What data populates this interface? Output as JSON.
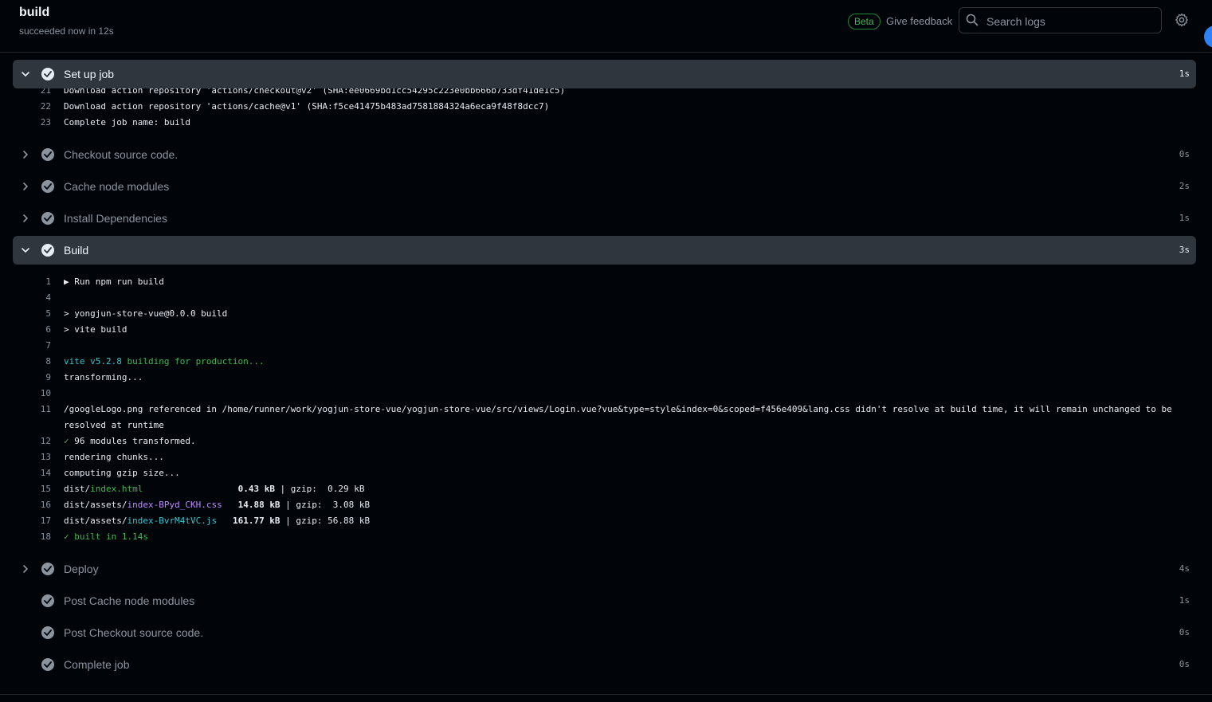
{
  "header": {
    "title": "build",
    "status": "succeeded now in 12s",
    "beta_label": "Beta",
    "feedback_label": "Give feedback",
    "search_placeholder": "Search logs"
  },
  "steps": [
    {
      "name": "Set up job",
      "duration": "1s",
      "expanded": true,
      "icon": "chevron-down-icon"
    },
    {
      "name": "Checkout source code.",
      "duration": "0s",
      "expanded": false,
      "icon": "chevron-right-icon"
    },
    {
      "name": "Cache node modules",
      "duration": "2s",
      "expanded": false,
      "icon": "chevron-right-icon"
    },
    {
      "name": "Install Dependencies",
      "duration": "1s",
      "expanded": false,
      "icon": "chevron-right-icon"
    },
    {
      "name": "Build",
      "duration": "3s",
      "expanded": true,
      "icon": "chevron-down-icon"
    },
    {
      "name": "Deploy",
      "duration": "4s",
      "expanded": false,
      "icon": "chevron-right-icon"
    },
    {
      "name": "Post Cache node modules",
      "duration": "1s",
      "expanded": false,
      "icon": "none"
    },
    {
      "name": "Post Checkout source code.",
      "duration": "0s",
      "expanded": false,
      "icon": "none"
    },
    {
      "name": "Complete job",
      "duration": "0s",
      "expanded": false,
      "icon": "none"
    }
  ],
  "setup_log": [
    {
      "n": "21",
      "t": "Download action repository 'actions/checkout@v2' (SHA:ee0669bd1cc54295c223e0bb666b733df41de1c5)"
    },
    {
      "n": "22",
      "t": "Download action repository 'actions/cache@v1' (SHA:f5ce41475b483ad7581884324a6eca9f48f8dcc7)"
    },
    {
      "n": "23",
      "t": "Complete job name: build"
    }
  ],
  "build_log": {
    "l1": {
      "n": "1",
      "t": "▶ Run npm run build"
    },
    "l4": {
      "n": "4"
    },
    "l5": {
      "n": "5",
      "t": "> yongjun-store-vue@0.0.0 build"
    },
    "l6": {
      "n": "6",
      "t": "> vite build"
    },
    "l7": {
      "n": "7"
    },
    "l8": {
      "n": "8",
      "a": "vite v5.2.8",
      "b": " building for production..."
    },
    "l9": {
      "n": "9",
      "t": "transforming..."
    },
    "l10": {
      "n": "10"
    },
    "l11": {
      "n": "11",
      "t": "/googleLogo.png referenced in /home/runner/work/yogjun-store-vue/yogjun-store-vue/src/views/Login.vue?vue&type=style&index=0&scoped=f456e409&lang.css didn't resolve at build time, it will remain unchanged to be resolved at runtime"
    },
    "l12": {
      "n": "12",
      "a": "✓",
      "b": " 96 modules transformed."
    },
    "l13": {
      "n": "13",
      "t": "rendering chunks..."
    },
    "l14": {
      "n": "14",
      "t": "computing gzip size..."
    },
    "l15": {
      "n": "15",
      "pre": "dist/",
      "file": "index.html",
      "pad": "                  ",
      "size": "0.43 kB",
      "mid": " | gzip:  0.29 kB"
    },
    "l16": {
      "n": "16",
      "pre": "dist/assets/",
      "file": "index-BPyd_CKH.css",
      "pad": "   ",
      "size": "14.88 kB",
      "mid": " | gzip:  3.08 kB"
    },
    "l17": {
      "n": "17",
      "pre": "dist/assets/",
      "file": "index-BvrM4tVC.js",
      "pad": "   ",
      "size": "161.77 kB",
      "mid": " | gzip: 56.88 kB"
    },
    "l18": {
      "n": "18",
      "t": "✓ built in 1.14s"
    }
  },
  "colors": {
    "accent_green": "#3fb950",
    "file_html": "#3fb950",
    "file_css": "#bc8cff",
    "file_js": "#39c5cf"
  }
}
